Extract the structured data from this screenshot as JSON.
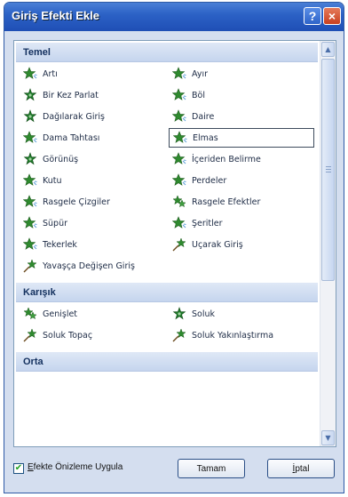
{
  "window": {
    "title": "Giriş Efekti Ekle",
    "help_label": "?",
    "close_label": "×"
  },
  "colors": {
    "titlebar": "#2c62c6",
    "section_header": "#c5d5ee",
    "icon_green": "#2f8a2f"
  },
  "sections": [
    {
      "label": "Temel",
      "items": [
        {
          "label": "Artı",
          "icon": "star-spark-icon"
        },
        {
          "label": "Ayır",
          "icon": "star-spark-icon"
        },
        {
          "label": "Bir Kez Parlat",
          "icon": "star-burst-icon"
        },
        {
          "label": "Böl",
          "icon": "star-spark-icon"
        },
        {
          "label": "Dağılarak Giriş",
          "icon": "star-burst-icon"
        },
        {
          "label": "Daire",
          "icon": "star-spark-icon"
        },
        {
          "label": "Dama Tahtası",
          "icon": "star-spark-icon"
        },
        {
          "label": "Elmas",
          "icon": "star-spark-icon",
          "selected": true
        },
        {
          "label": "Görünüş",
          "icon": "star-burst-icon"
        },
        {
          "label": "İçeriden Belirme",
          "icon": "star-spark-icon"
        },
        {
          "label": "Kutu",
          "icon": "star-spark-icon"
        },
        {
          "label": "Perdeler",
          "icon": "star-spark-icon"
        },
        {
          "label": "Rasgele Çizgiler",
          "icon": "star-spark-icon"
        },
        {
          "label": "Rasgele Efektler",
          "icon": "star-cluster-icon"
        },
        {
          "label": "Süpür",
          "icon": "star-spark-icon"
        },
        {
          "label": "Şeritler",
          "icon": "star-spark-icon"
        },
        {
          "label": "Tekerlek",
          "icon": "star-spark-icon"
        },
        {
          "label": "Uçarak Giriş",
          "icon": "star-fly-icon"
        },
        {
          "label": "Yavaşça Değişen Giriş",
          "icon": "star-fly-icon"
        }
      ]
    },
    {
      "label": "Karışık",
      "items": [
        {
          "label": "Genişlet",
          "icon": "star-cluster-icon"
        },
        {
          "label": "Soluk",
          "icon": "star-burst-icon"
        },
        {
          "label": "Soluk Topaç",
          "icon": "star-fly-icon"
        },
        {
          "label": "Soluk Yakınlaştırma",
          "icon": "star-fly-icon"
        }
      ]
    },
    {
      "label": "Orta",
      "items": []
    }
  ],
  "footer": {
    "preview_label_u": "E",
    "preview_label_rest": "fekte Önizleme Uygula",
    "preview_checked": true,
    "ok_label": "Tamam",
    "cancel_label_u": "İ",
    "cancel_label_rest": "ptal"
  }
}
